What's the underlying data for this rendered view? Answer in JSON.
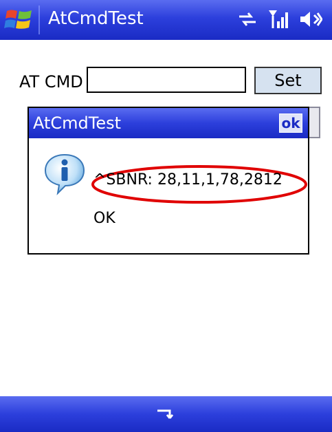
{
  "window": {
    "title": "AtCmdTest"
  },
  "status_icons": [
    "connectivity-icon",
    "signal-strength-icon",
    "volume-icon"
  ],
  "form": {
    "label": "AT CMD",
    "input_value": "",
    "set_label": "Set"
  },
  "dialog": {
    "title": "AtCmdTest",
    "ok_label": "ok",
    "icon": "info-icon",
    "lines": [
      "^SBNR: 28,11,1,78,2812",
      "OK"
    ],
    "highlight_color": "#e00000"
  },
  "bottom_bar": {
    "icon": "keyboard-icon"
  },
  "colors": {
    "titlebar": "#2c3fdc",
    "button_face": "#d6e2f0"
  }
}
